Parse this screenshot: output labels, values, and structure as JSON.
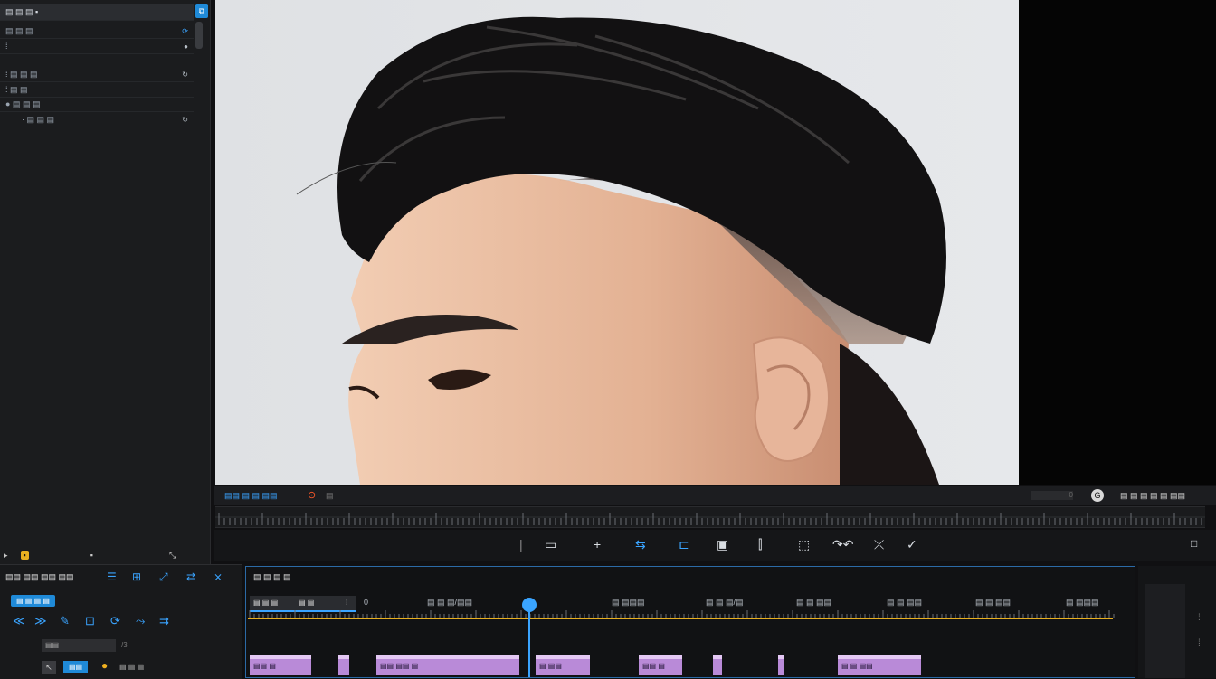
{
  "left_panel": {
    "header": {
      "title": "▤ ▤ ▤ ▪",
      "button_label": "⧉"
    },
    "rows": [
      {
        "label": "▤ ▤ ▤",
        "icon": "⟳"
      },
      {
        "label": "⁞",
        "icon": "●"
      },
      {
        "label": "⁞ ▤ ▤ ▤",
        "icon": "↻"
      },
      {
        "label": "⁞ ▤ ▤",
        "icon": ""
      },
      {
        "label": "● ▤ ▤ ▤",
        "icon": ""
      },
      {
        "label": "· ▤ ▤ ▤",
        "icon": "↻"
      }
    ],
    "bottom": {
      "left": "▸",
      "mid": "▪",
      "right": "⤡"
    }
  },
  "program_bar": {
    "title": "▤▤ ▤ ▤ ▤▤",
    "mid_icon": "⊙",
    "mid_text": "▤",
    "right_text": "▤ ▤ ▤ ▤ ▤ ▤▤",
    "right_num": "0"
  },
  "transport": {
    "buttons": [
      {
        "name": "mark-in-button",
        "glyph": "▭"
      },
      {
        "name": "add-marker-button",
        "glyph": "+"
      },
      {
        "name": "step-back-button",
        "glyph": "⇆"
      },
      {
        "name": "loop-button",
        "glyph": "⊏"
      },
      {
        "name": "camera-button",
        "glyph": "▣"
      },
      {
        "name": "lift-button",
        "glyph": "⫿"
      },
      {
        "name": "extract-button",
        "glyph": "⬚"
      },
      {
        "name": "speed-button",
        "glyph": "↷↶"
      },
      {
        "name": "trim-button",
        "glyph": "⤫"
      },
      {
        "name": "confirm-button",
        "glyph": "✓"
      }
    ],
    "left_marker": "|",
    "right_icon": "□"
  },
  "tools": {
    "title": "▤▤ ▤▤ ▤▤ ▤▤",
    "icons": [
      "☰",
      "⊞",
      "⤢",
      "⇄",
      "⨯"
    ],
    "active_tab": "▤ ▤ ▤ ▤",
    "row2": [
      "≪",
      "≫",
      "✎",
      "⊡",
      "⟳",
      "⤳",
      "⇉"
    ],
    "field_value": "▤▤",
    "field_suffix": "/3",
    "bottom_btn": "▤▤",
    "bottom_label": "▤ ▤ ▤"
  },
  "timeline": {
    "title": "▤ ▤ ▤ ▤",
    "in_label": "▤ ▤ ▤",
    "out_label": "▤ ▤",
    "ticks": [
      "▤ ▤ ▤/▤▤",
      "▤ ▤▤▤",
      "▤ ▤ ▤/▤",
      "▤ ▤ ▤▤",
      "▤ ▤ ▤▤",
      "▤ ▤ ▤▤",
      "▤ ▤▤▤"
    ],
    "start_tick": "0",
    "clips": [
      "▤▤ ▤",
      "",
      "▤▤ ▤▤ ▤",
      "▤ ▤▤",
      "▤▤ ▤",
      "",
      "",
      "▤ ▤ ▤▤"
    ]
  },
  "colors": {
    "accent": "#1f8ad8",
    "playhead": "#3aa4ff",
    "clip": "#b98ad8",
    "timeline_border": "#2b6aa6",
    "yellow_line": "#e8b020"
  }
}
